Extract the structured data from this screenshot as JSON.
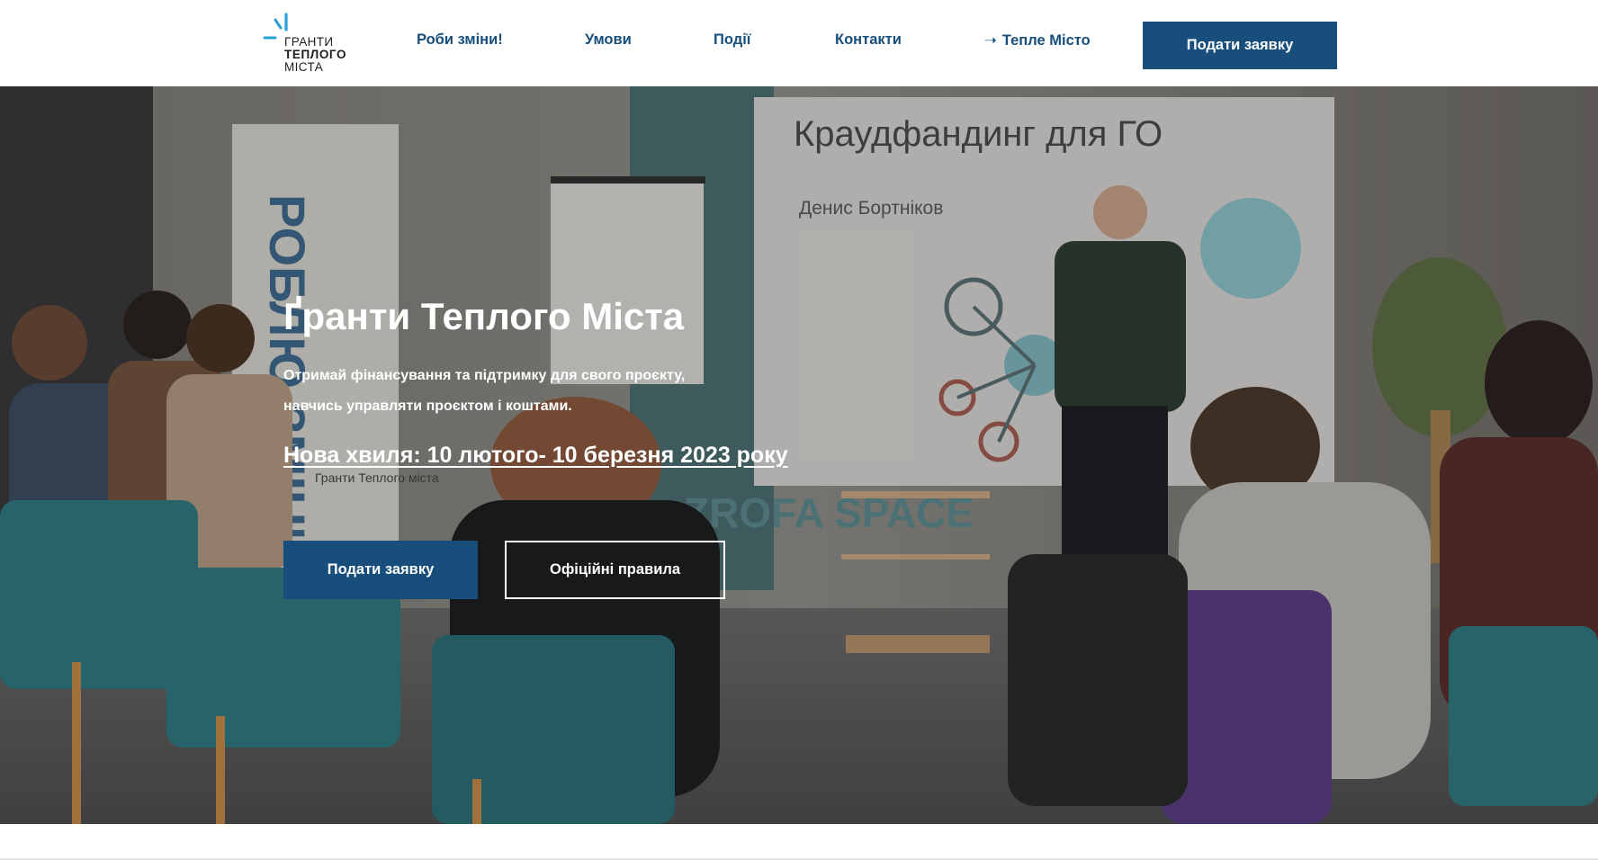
{
  "header": {
    "logo": {
      "line1": "ГРАНТИ",
      "line2": "ТЕПЛОГО",
      "line3": "МІСТА",
      "accent_color": "#2a9fd8"
    },
    "nav": [
      {
        "label": "Роби зміни!"
      },
      {
        "label": "Умови"
      },
      {
        "label": "Події"
      },
      {
        "label": "Контакти"
      },
      {
        "label": "Тепле Місто",
        "icon": "arrow-right-icon",
        "icon_glyph": "➝"
      }
    ],
    "cta_label": "Подати заявку"
  },
  "hero": {
    "title": "Ґранти Теплого Міста",
    "description_line1": "Отримай фінансування та підтримку для свого проєкту,",
    "description_line2": "навчись управляти проєктом і коштами.",
    "wave": "Нова хвиля: 10 лютого- 10 березня 2023 року",
    "primary_button": "Подати заявку",
    "secondary_button": "Офіційні правила",
    "photo": {
      "slide_title": "Краудфандинг для ГО",
      "slide_speaker": "Денис Бортніков",
      "banner_text": "РОБЛЮ ЗМІНИ",
      "banner_small": "Гранти Теплого міста",
      "space_text": "ZROFA SPACE"
    }
  },
  "colors": {
    "brand": "#174e7b",
    "header_bg": "#ffffff",
    "hero_text": "#ffffff"
  }
}
